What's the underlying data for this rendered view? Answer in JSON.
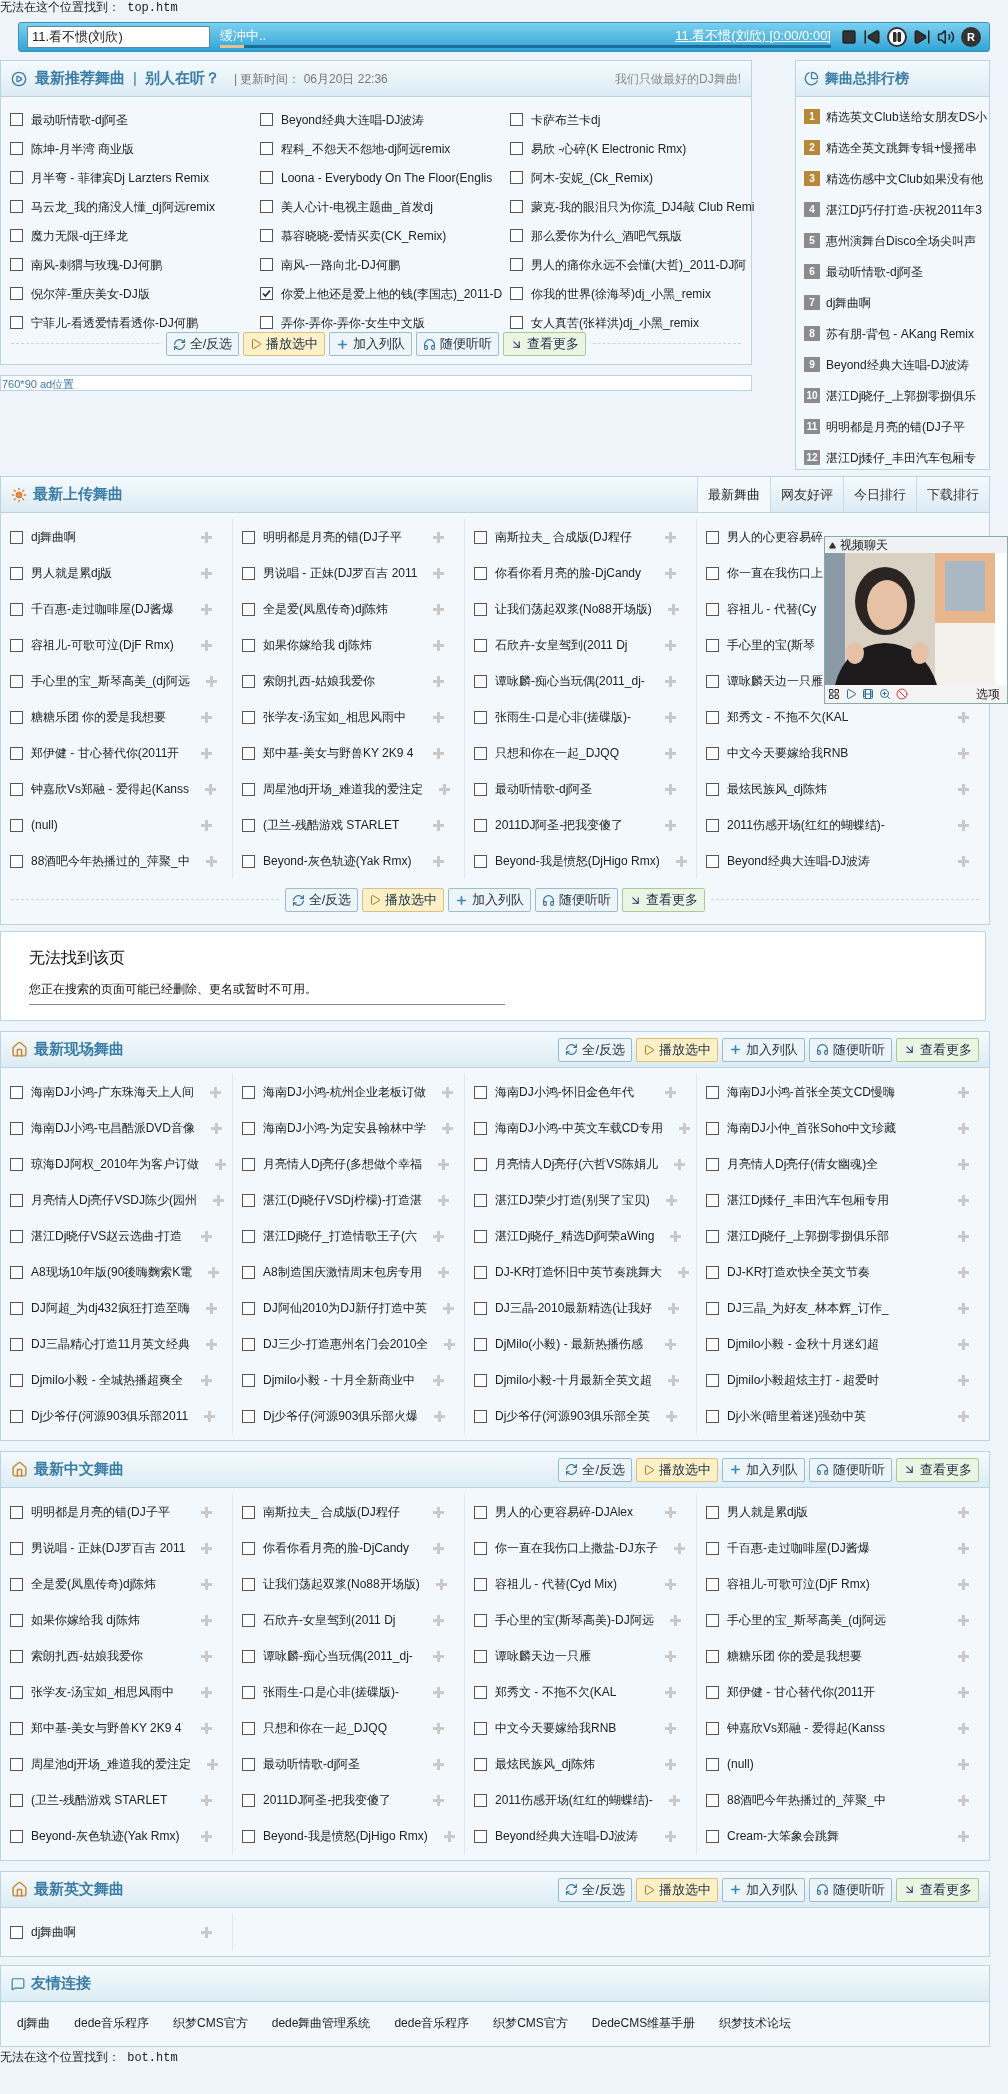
{
  "top_notice": "无法在这个位置找到： top.htm",
  "player": {
    "value": "11.看不惯(刘欣)",
    "status": "缓冲中..",
    "level": 0.04,
    "now_playing": "11.看不惯(刘欣)",
    "time": "[0:00/0:00]",
    "mode_label": "R"
  },
  "recommended": {
    "title": "最新推荐舞曲",
    "separator": "|",
    "listening": "别人在听？",
    "updated": "| 更新时间： 06月20日 22:36",
    "slogan": "我们只做最好的DJ舞曲!",
    "items": [
      {
        "title": "最动听情歌-dj阿圣",
        "checked": false
      },
      {
        "title": "Beyond经典大连唱-DJ波涛",
        "checked": false
      },
      {
        "title": "卡萨布兰卡dj",
        "checked": false
      },
      {
        "title": "陈坤-月半湾 商业版",
        "checked": false
      },
      {
        "title": "程科_不怨天不怨地-dj阿远remix",
        "checked": false
      },
      {
        "title": "易欣 -心碎(K Electronic Rmx)",
        "checked": false
      },
      {
        "title": "月半弯 - 菲律宾Dj Larzters Remix",
        "checked": false
      },
      {
        "title": "Loona - Everybody On The Floor(Englis",
        "checked": false
      },
      {
        "title": "阿木-安妮_(Ck_Remix)",
        "checked": false
      },
      {
        "title": "马云龙_我的痛没人懂_dj阿远remix",
        "checked": false
      },
      {
        "title": "美人心计-电视主题曲_首发dj",
        "checked": false
      },
      {
        "title": "蒙克-我的眼泪只为你流_DJ4敲 Club Remi",
        "checked": false
      },
      {
        "title": "魔力无限-dj王绎龙",
        "checked": false
      },
      {
        "title": "慕容晓晓-爱情买卖(CK_Remix)",
        "checked": false
      },
      {
        "title": "那么爱你为什么_酒吧气氛版",
        "checked": false
      },
      {
        "title": "南风-刺猬与玫瑰-DJ何鹏",
        "checked": false
      },
      {
        "title": "南风-一路向北-DJ何鹏",
        "checked": false
      },
      {
        "title": "男人的痛你永远不会懂(大哲)_2011-DJ阿",
        "checked": false
      },
      {
        "title": "倪尔萍-重庆美女-DJ版",
        "checked": false
      },
      {
        "title": "你爱上他还是爱上他的钱(李国志)_2011-D",
        "checked": true
      },
      {
        "title": "你我的世界(徐海琴)dj_小黑_remix",
        "checked": false
      },
      {
        "title": "宁菲儿-看透爱情看透你-DJ何鹏",
        "checked": false
      },
      {
        "title": "弄你-弄你-弄你-女生中文版",
        "checked": false
      },
      {
        "title": "女人真苦(张祥洪)dj_小黑_remix",
        "checked": false
      }
    ],
    "buttons": [
      {
        "label": "全/反选",
        "kind": "select"
      },
      {
        "label": "播放选中",
        "kind": "play"
      },
      {
        "label": "加入列队",
        "kind": "queue"
      },
      {
        "label": "随便听听",
        "kind": "random"
      },
      {
        "label": "查看更多",
        "kind": "more"
      }
    ]
  },
  "ad": "760*90 ad位置",
  "ranking": {
    "title": "舞曲总排行榜",
    "items": [
      {
        "rank": "1",
        "title": "精选英文Club送给女朋友DS小",
        "color": "#b8883a"
      },
      {
        "rank": "2",
        "title": "精选全英文跳舞专辑+慢摇串",
        "color": "#b8883a"
      },
      {
        "rank": "3",
        "title": "精选伤感中文Club如果没有他",
        "color": "#b8883a"
      },
      {
        "rank": "4",
        "title": "湛江Dj巧仔打造-庆祝2011年3",
        "color": "#8c8c8c"
      },
      {
        "rank": "5",
        "title": "惠州演舞台Disco全场尖叫声",
        "color": "#8c8c8c"
      },
      {
        "rank": "6",
        "title": "最动听情歌-dj阿圣",
        "color": "#8c8c8c"
      },
      {
        "rank": "7",
        "title": "dj舞曲啊",
        "color": "#8c8c8c"
      },
      {
        "rank": "8",
        "title": "苏有朋-背包 - AKang Remix",
        "color": "#8c8c8c"
      },
      {
        "rank": "9",
        "title": "Beyond经典大连唱-DJ波涛",
        "color": "#8c8c8c"
      },
      {
        "rank": "10",
        "title": "湛江Dj晓仔_上郭捌零捌俱乐",
        "color": "#8c8c8c"
      },
      {
        "rank": "11",
        "title": "明明都是月亮的错(DJ子平",
        "color": "#8c8c8c"
      },
      {
        "rank": "12",
        "title": "湛江Dj矮仔_丰田汽车包厢专",
        "color": "#8c8c8c"
      }
    ]
  },
  "upload": {
    "title": "最新上传舞曲",
    "tabs": [
      {
        "label": "最新舞曲",
        "selected": true
      },
      {
        "label": "网友好评",
        "selected": false
      },
      {
        "label": "今日排行",
        "selected": false
      },
      {
        "label": "下载排行",
        "selected": false
      }
    ],
    "items": [
      {
        "title": "dj舞曲啊",
        "checked": false
      },
      {
        "title": "明明都是月亮的错(DJ子平",
        "checked": false
      },
      {
        "title": "南斯拉夫_ 合成版(DJ程仔",
        "checked": false
      },
      {
        "title": "男人的心更容易碎",
        "checked": false
      },
      {
        "title": "男人就是累dj版",
        "checked": false
      },
      {
        "title": "男说唱 - 正妹(DJ罗百吉 2011",
        "checked": false
      },
      {
        "title": "你看你看月亮的脸-DjCandy",
        "checked": false
      },
      {
        "title": "你一直在我伤口上",
        "checked": false
      },
      {
        "title": "千百惠-走过咖啡屋(DJ酱爆",
        "checked": false
      },
      {
        "title": "全是爱(凤凰传奇)dj陈炜",
        "checked": false
      },
      {
        "title": "让我们荡起双浆(No88开场版)",
        "checked": false
      },
      {
        "title": "容祖儿 - 代替(Cy",
        "checked": false
      },
      {
        "title": "容祖儿-可歌可泣(DjF Rmx)",
        "checked": false
      },
      {
        "title": "如果你嫁给我 dj陈炜",
        "checked": false
      },
      {
        "title": "石欣卉-女皇驾到(2011 Dj",
        "checked": false
      },
      {
        "title": "手心里的宝(斯琴",
        "checked": false
      },
      {
        "title": "手心里的宝_斯琴高美_(dj阿远",
        "checked": false
      },
      {
        "title": "索朗扎西-姑娘我爱你",
        "checked": false
      },
      {
        "title": "谭咏麟-痴心当玩偶(2011_dj-",
        "checked": false
      },
      {
        "title": "谭咏麟天边一只雁",
        "checked": false
      },
      {
        "title": "糖糖乐团 你的爱是我想要",
        "checked": false
      },
      {
        "title": "张学友-汤宝如_相思风雨中",
        "checked": false
      },
      {
        "title": "张雨生-口是心非(搓碟版)-",
        "checked": false
      },
      {
        "title": "郑秀文 - 不拖不欠(KAL",
        "checked": false
      },
      {
        "title": "郑伊健 - 甘心替代你(2011开",
        "checked": false
      },
      {
        "title": "郑中基-美女与野兽KY 2K9 4",
        "checked": false
      },
      {
        "title": "只想和你在一起_DJQQ",
        "checked": false
      },
      {
        "title": "中文今天要嫁给我RNB",
        "checked": false
      },
      {
        "title": "钟嘉欣Vs郑融 - 爱得起(Kanss",
        "checked": false
      },
      {
        "title": "周星池dj开场_难道我的爱注定",
        "checked": false
      },
      {
        "title": "最动听情歌-dj阿圣",
        "checked": false
      },
      {
        "title": "最炫民族风_dj陈炜",
        "checked": false
      },
      {
        "title": "(null)",
        "checked": false
      },
      {
        "title": "(卫兰-残酷游戏 STARLET",
        "checked": false
      },
      {
        "title": "2011DJ阿圣-把我变傻了",
        "checked": false
      },
      {
        "title": "2011伤感开场(红红的蝴蝶结)-",
        "checked": false
      },
      {
        "title": "88酒吧今年热播过的_萍聚_中",
        "checked": false
      },
      {
        "title": "Beyond-灰色轨迹(Yak Rmx)",
        "checked": false
      },
      {
        "title": "Beyond-我是愤怒(DjHigo Rmx)",
        "checked": false
      },
      {
        "title": "Beyond经典大连唱-DJ波涛",
        "checked": false
      }
    ],
    "buttons": [
      {
        "label": "全/反选",
        "kind": "select"
      },
      {
        "label": "播放选中",
        "kind": "play"
      },
      {
        "label": "加入列队",
        "kind": "queue"
      },
      {
        "label": "随便听听",
        "kind": "random"
      },
      {
        "label": "查看更多",
        "kind": "more"
      }
    ]
  },
  "video_chat": {
    "title": "视频聊天",
    "options": "选项"
  },
  "error_box": {
    "title": "无法找到该页",
    "message": "您正在搜索的页面可能已经删除、更名或暂时不可用。"
  },
  "live": {
    "title": "最新现场舞曲",
    "buttons": [
      {
        "label": "全/反选",
        "kind": "select"
      },
      {
        "label": "播放选中",
        "kind": "play"
      },
      {
        "label": "加入列队",
        "kind": "queue"
      },
      {
        "label": "随便听听",
        "kind": "random"
      },
      {
        "label": "查看更多",
        "kind": "more"
      }
    ],
    "items": [
      {
        "title": "海南DJ小鸿-广东珠海天上人间",
        "checked": false
      },
      {
        "title": "海南DJ小鸿-杭州企业老板订做",
        "checked": false
      },
      {
        "title": "海南DJ小鸿-怀旧金色年代",
        "checked": false
      },
      {
        "title": "海南DJ小鸿-首张全英文CD慢嗨",
        "checked": false
      },
      {
        "title": "海南DJ小鸿-屯昌酷派DVD音像",
        "checked": false
      },
      {
        "title": "海南DJ小鸿-为定安县翰林中学",
        "checked": false
      },
      {
        "title": "海南DJ小鸿-中英文车载CD专用",
        "checked": false
      },
      {
        "title": "海南DJ小仲_首张Soho中文珍藏",
        "checked": false
      },
      {
        "title": "琼海DJ阿权_2010年为客户订做",
        "checked": false
      },
      {
        "title": "月亮情人Dj亮仔(多想做个幸福",
        "checked": false
      },
      {
        "title": "月亮情人Dj亮仔(六哲VS陈娟儿",
        "checked": false
      },
      {
        "title": "月亮情人Dj亮仔(倩女幽魂)全",
        "checked": false
      },
      {
        "title": "月亮情人Dj亮仔VSDJ陈少(园州",
        "checked": false
      },
      {
        "title": "湛江(Dj晓仔VSDj柠檬)-打造湛",
        "checked": false
      },
      {
        "title": "湛江DJ荣少打造(别哭了宝贝)",
        "checked": false
      },
      {
        "title": "湛江Dj矮仔_丰田汽车包厢专用",
        "checked": false
      },
      {
        "title": "湛江Dj晓仔VS赵云选曲-打造",
        "checked": false
      },
      {
        "title": "湛江Dj晓仔_打造情歌王子(六",
        "checked": false
      },
      {
        "title": "湛江Dj晓仔_精选Dj阿荣aWing",
        "checked": false
      },
      {
        "title": "湛江Dj晓仔_上郭捌零捌俱乐部",
        "checked": false
      },
      {
        "title": "A8现场10年版(90後嗨麴索K電",
        "checked": false
      },
      {
        "title": "A8制造国庆激情周末包房专用",
        "checked": false
      },
      {
        "title": "DJ-KR打造怀旧中英节奏跳舞大",
        "checked": false
      },
      {
        "title": "DJ-KR打造欢快全英文节奏",
        "checked": false
      },
      {
        "title": "DJ阿超_为dj432疯狂打造至嗨",
        "checked": false
      },
      {
        "title": "DJ阿仙2010为DJ新仔打造中英",
        "checked": false
      },
      {
        "title": "DJ三晶-2010最新精选(让我好",
        "checked": false
      },
      {
        "title": "DJ三晶_为好友_林本辉_订作_",
        "checked": false
      },
      {
        "title": "DJ三晶精心打造11月英文经典",
        "checked": false
      },
      {
        "title": "DJ三少-打造惠州名门会2010全",
        "checked": false
      },
      {
        "title": "DjMilo(小毅) - 最新热播伤感",
        "checked": false
      },
      {
        "title": "Djmilo小毅 - 金秋十月迷幻超",
        "checked": false
      },
      {
        "title": "Djmilo小毅 - 全城热播超爽全",
        "checked": false
      },
      {
        "title": "Djmilo小毅 - 十月全新商业中",
        "checked": false
      },
      {
        "title": "Djmilo小毅-十月最新全英文超",
        "checked": false
      },
      {
        "title": "Djmilo小毅超炫主打 - 超爱时",
        "checked": false
      },
      {
        "title": "Dj少爷仔(河源903俱乐部2011",
        "checked": false
      },
      {
        "title": "Dj少爷仔(河源903俱乐部火爆",
        "checked": false
      },
      {
        "title": "Dj少爷仔(河源903俱乐部全英",
        "checked": false
      },
      {
        "title": "Dj小米(暗里着迷)强劲中英",
        "checked": false
      }
    ]
  },
  "chinese": {
    "title": "最新中文舞曲",
    "buttons": [
      {
        "label": "全/反选",
        "kind": "select"
      },
      {
        "label": "播放选中",
        "kind": "play"
      },
      {
        "label": "加入列队",
        "kind": "queue"
      },
      {
        "label": "随便听听",
        "kind": "random"
      },
      {
        "label": "查看更多",
        "kind": "more"
      }
    ],
    "items": [
      {
        "title": "明明都是月亮的错(DJ子平",
        "checked": false
      },
      {
        "title": "南斯拉夫_ 合成版(DJ程仔",
        "checked": false
      },
      {
        "title": "男人的心更容易碎-DJAlex",
        "checked": false
      },
      {
        "title": "男人就是累dj版",
        "checked": false
      },
      {
        "title": "男说唱 - 正妹(DJ罗百吉 2011",
        "checked": false
      },
      {
        "title": "你看你看月亮的脸-DjCandy",
        "checked": false
      },
      {
        "title": "你一直在我伤口上撒盐-DJ东子",
        "checked": false
      },
      {
        "title": "千百惠-走过咖啡屋(DJ酱爆",
        "checked": false
      },
      {
        "title": "全是爱(凤凰传奇)dj陈炜",
        "checked": false
      },
      {
        "title": "让我们荡起双浆(No88开场版)",
        "checked": false
      },
      {
        "title": "容祖儿 - 代替(Cyd Mix)",
        "checked": false
      },
      {
        "title": "容祖儿-可歌可泣(DjF Rmx)",
        "checked": false
      },
      {
        "title": "如果你嫁给我 dj陈炜",
        "checked": false
      },
      {
        "title": "石欣卉-女皇驾到(2011 Dj",
        "checked": false
      },
      {
        "title": "手心里的宝(斯琴高美)-DJ阿远",
        "checked": false
      },
      {
        "title": "手心里的宝_斯琴高美_(dj阿远",
        "checked": false
      },
      {
        "title": "索朗扎西-姑娘我爱你",
        "checked": false
      },
      {
        "title": "谭咏麟-痴心当玩偶(2011_dj-",
        "checked": false
      },
      {
        "title": "谭咏麟天边一只雁",
        "checked": false
      },
      {
        "title": "糖糖乐团 你的爱是我想要",
        "checked": false
      },
      {
        "title": "张学友-汤宝如_相思风雨中",
        "checked": false
      },
      {
        "title": "张雨生-口是心非(搓碟版)-",
        "checked": false
      },
      {
        "title": "郑秀文 - 不拖不欠(KAL",
        "checked": false
      },
      {
        "title": "郑伊健 - 甘心替代你(2011开",
        "checked": false
      },
      {
        "title": "郑中基-美女与野兽KY 2K9 4",
        "checked": false
      },
      {
        "title": "只想和你在一起_DJQQ",
        "checked": false
      },
      {
        "title": "中文今天要嫁给我RNB",
        "checked": false
      },
      {
        "title": "钟嘉欣Vs郑融 - 爱得起(Kanss",
        "checked": false
      },
      {
        "title": "周星池dj开场_难道我的爱注定",
        "checked": false
      },
      {
        "title": "最动听情歌-dj阿圣",
        "checked": false
      },
      {
        "title": "最炫民族风_dj陈炜",
        "checked": false
      },
      {
        "title": "(null)",
        "checked": false
      },
      {
        "title": "(卫兰-残酷游戏 STARLET",
        "checked": false
      },
      {
        "title": "2011DJ阿圣-把我变傻了",
        "checked": false
      },
      {
        "title": "2011伤感开场(红红的蝴蝶结)-",
        "checked": false
      },
      {
        "title": "88酒吧今年热播过的_萍聚_中",
        "checked": false
      },
      {
        "title": "Beyond-灰色轨迹(Yak Rmx)",
        "checked": false
      },
      {
        "title": "Beyond-我是愤怒(DjHigo Rmx)",
        "checked": false
      },
      {
        "title": "Beyond经典大连唱-DJ波涛",
        "checked": false
      },
      {
        "title": "Cream-大笨象会跳舞",
        "checked": false
      }
    ]
  },
  "english": {
    "title": "最新英文舞曲",
    "buttons": [
      {
        "label": "全/反选",
        "kind": "select"
      },
      {
        "label": "播放选中",
        "kind": "play"
      },
      {
        "label": "加入列队",
        "kind": "queue"
      },
      {
        "label": "随便听听",
        "kind": "random"
      },
      {
        "label": "查看更多",
        "kind": "more"
      }
    ],
    "items": [
      {
        "title": "dj舞曲啊",
        "checked": false
      }
    ]
  },
  "links": {
    "title": "友情连接",
    "items": [
      "dj舞曲",
      "dede音乐程序",
      "织梦CMS官方",
      "dede舞曲管理系统",
      "dede音乐程序",
      "织梦CMS官方",
      "DedeCMS维基手册",
      "织梦技术论坛"
    ]
  },
  "bottom_notice": "无法在这个位置找到： bot.htm"
}
